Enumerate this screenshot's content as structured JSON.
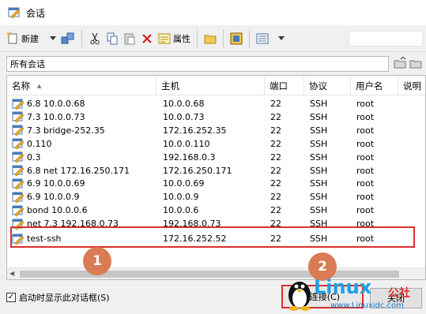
{
  "window": {
    "title": "会话"
  },
  "toolbar": {
    "new_label": "新建",
    "properties_label": "属性"
  },
  "path": {
    "current": "所有会话"
  },
  "columns": [
    "名称",
    "主机",
    "端口",
    "协议",
    "用户名",
    "说明"
  ],
  "sessions": [
    {
      "name": "6.8 10.0.0.68",
      "host": "10.0.0.68",
      "port": "22",
      "protocol": "SSH",
      "user": "root"
    },
    {
      "name": "7.3 10.0.0.73",
      "host": "10.0.0.73",
      "port": "22",
      "protocol": "SSH",
      "user": "root"
    },
    {
      "name": "7.3 bridge-252.35",
      "host": "172.16.252.35",
      "port": "22",
      "protocol": "SSH",
      "user": "root"
    },
    {
      "name": "0.110",
      "host": "10.0.0.110",
      "port": "22",
      "protocol": "SSH",
      "user": "root"
    },
    {
      "name": "0.3",
      "host": "192.168.0.3",
      "port": "22",
      "protocol": "SSH",
      "user": "root"
    },
    {
      "name": "6.8 net 172.16.250.171",
      "host": "172.16.250.171",
      "port": "22",
      "protocol": "SSH",
      "user": "root"
    },
    {
      "name": "6.9 10.0.0.69",
      "host": "10.0.0.69",
      "port": "22",
      "protocol": "SSH",
      "user": "root"
    },
    {
      "name": "6.9 10.0.0.9",
      "host": "10.0.0.9",
      "port": "22",
      "protocol": "SSH",
      "user": "root"
    },
    {
      "name": "bond 10.0.0.6",
      "host": "10.0.0.6",
      "port": "22",
      "protocol": "SSH",
      "user": "root"
    },
    {
      "name": "net 7.3 192.168.0.73",
      "host": "192.168.0.73",
      "port": "22",
      "protocol": "SSH",
      "user": "root"
    },
    {
      "name": "test-ssh",
      "host": "172.16.252.52",
      "port": "22",
      "protocol": "SSH",
      "user": "root"
    }
  ],
  "annotations": {
    "badge1": "1",
    "badge2": "2"
  },
  "footer": {
    "startup_checkbox_label": "启动时显示此对话框(S)",
    "startup_checked": true,
    "connect_label": "连接(C)",
    "close_label": "关闭"
  },
  "watermark": {
    "brand": "Linux",
    "brand_suffix": "公社",
    "url": "www.Linuxidc.com"
  },
  "colors": {
    "highlight": "#d9302d",
    "badge": "#d97c55",
    "watermark_blue": "#1aa0e3"
  }
}
